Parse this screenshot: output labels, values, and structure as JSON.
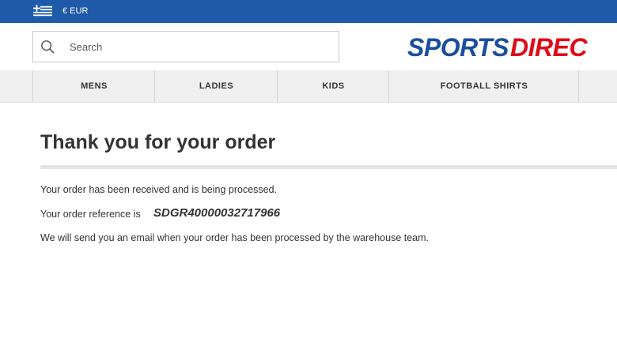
{
  "topbar": {
    "currency": "€ EUR",
    "flag_icon": "greece-flag-icon",
    "background": "#1e5aa8"
  },
  "search": {
    "placeholder": "Search",
    "value": "",
    "icon": "search-icon"
  },
  "logo": {
    "text_part1": "SPORTS",
    "text_part2": "DIREC",
    "color_blue": "#1a4fa0",
    "color_red": "#e10b17"
  },
  "nav": {
    "items": [
      {
        "label": "MENS"
      },
      {
        "label": "LADIES"
      },
      {
        "label": "KIDS"
      },
      {
        "label": "FOOTBALL SHIRTS"
      }
    ]
  },
  "confirmation": {
    "title": "Thank you for your order",
    "received_message": "Your order has been received and is being processed.",
    "reference_label": "Your order reference is",
    "reference_number": "SDGR40000032717966",
    "email_message": "We will send you an email when your order has been processed by the warehouse team."
  }
}
